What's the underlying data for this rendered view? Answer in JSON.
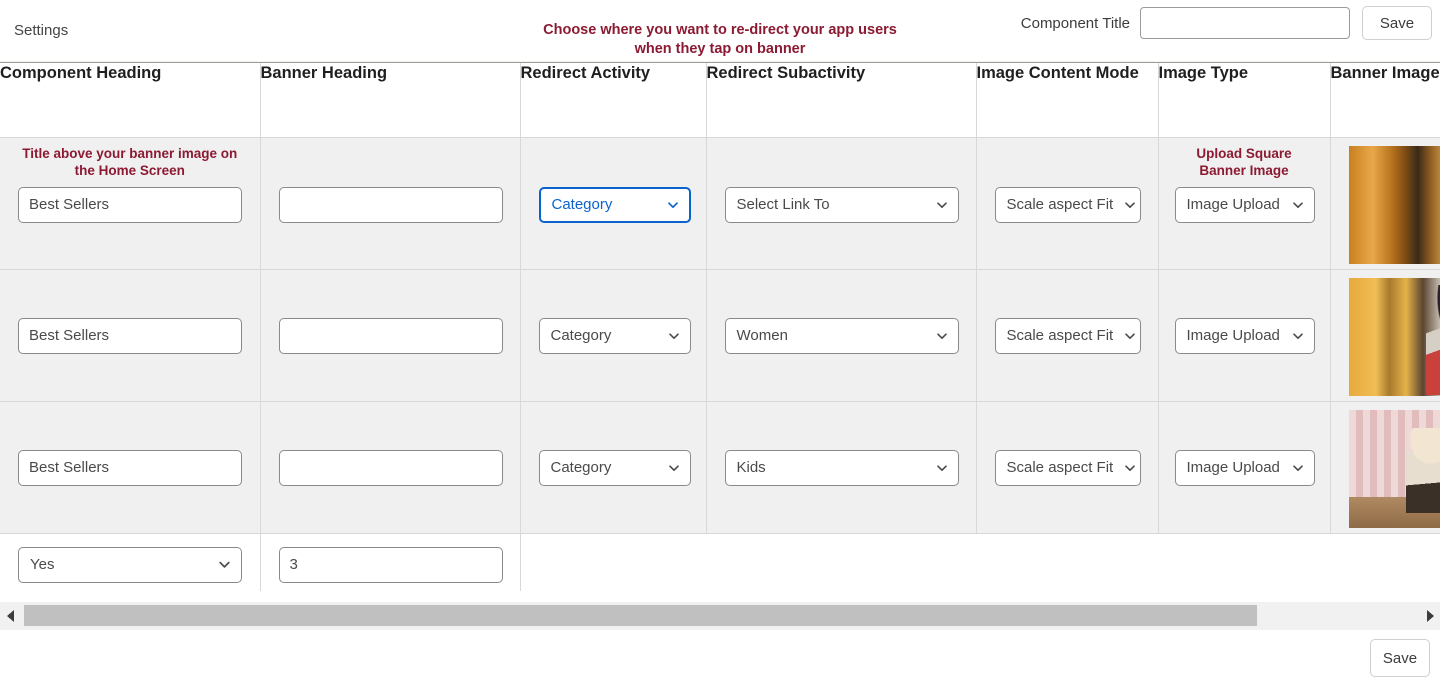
{
  "topbar": {
    "settings_label": "Settings",
    "banner_note": "Choose where you want to re-direct your app users when they tap on banner",
    "component_title_label": "Component Title",
    "component_title_value": "",
    "component_title_placeholder": "",
    "save_label": "Save"
  },
  "colors": {
    "accent_red": "#8B1A32",
    "focus_blue": "#0b63ce",
    "row_bg": "#f0f0f0",
    "scrollbar_thumb": "#c0c0c0"
  },
  "table": {
    "columns": [
      {
        "key": "component_heading",
        "label": "Component Heading"
      },
      {
        "key": "banner_heading",
        "label": "Banner Heading"
      },
      {
        "key": "redirect_activity",
        "label": "Redirect Activity"
      },
      {
        "key": "redirect_subactivity",
        "label": "Redirect Subactivity"
      },
      {
        "key": "image_content_mode",
        "label": "Image Content Mode"
      },
      {
        "key": "image_type",
        "label": "Image Type"
      },
      {
        "key": "banner_image",
        "label": "Banner Image"
      }
    ],
    "hints": {
      "component_heading": "Title above your banner image on the Home Screen",
      "image_type": "Upload Square Banner Image"
    },
    "rows": [
      {
        "component_heading": "Best Sellers",
        "banner_heading": "",
        "redirect_activity": "Category",
        "redirect_activity_focused": true,
        "redirect_subactivity": "Select Link To",
        "image_content_mode": "Scale aspect Fit",
        "image_type": "Image Upload",
        "banner_image_alt": "man-with-backpack-banner"
      },
      {
        "component_heading": "Best Sellers",
        "banner_heading": "",
        "redirect_activity": "Category",
        "redirect_activity_focused": false,
        "redirect_subactivity": "Women",
        "image_content_mode": "Scale aspect Fit",
        "image_type": "Image Upload",
        "banner_image_alt": "woman-with-red-scarf-banner"
      },
      {
        "component_heading": "Best Sellers",
        "banner_heading": "",
        "redirect_activity": "Category",
        "redirect_activity_focused": false,
        "redirect_subactivity": "Kids",
        "image_content_mode": "Scale aspect Fit",
        "image_type": "Image Upload",
        "banner_image_alt": "kids-on-striped-wall-banner"
      }
    ],
    "bottom_row": {
      "enabled_value": "Yes",
      "count_value": "3"
    }
  },
  "scrollbar": {
    "left_arrow": "◀",
    "right_arrow": "▶"
  },
  "footer": {
    "save_label": "Save"
  }
}
